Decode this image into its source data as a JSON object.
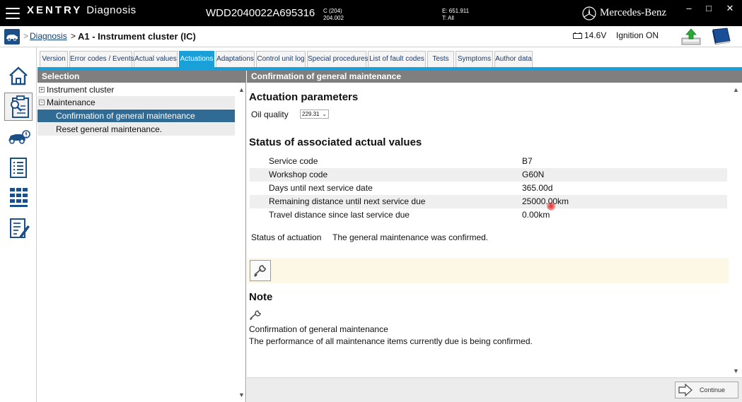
{
  "topbar": {
    "brand_bold": "XENTRY",
    "brand_rest": "Diagnosis",
    "vin": "WDD2040022A695316",
    "model_line1": "C (204)",
    "model_line2": "204.002",
    "engine_line1": "E: 651.911",
    "engine_line2": "T: All",
    "maker": "Mercedes-Benz",
    "minimize": "–",
    "maximize": "□",
    "close": "✕"
  },
  "breadcrumb": {
    "separator1": ">",
    "link": "Diagnosis",
    "separator2": ">",
    "current": "A1 - Instrument cluster (IC)"
  },
  "status": {
    "voltage": "14.6V",
    "ignition": "Ignition ON"
  },
  "tabs": [
    {
      "label": "Version"
    },
    {
      "label": "Error codes / Events"
    },
    {
      "label": "Actual values"
    },
    {
      "label": "Actuations"
    },
    {
      "label": "Adaptations"
    },
    {
      "label": "Control unit log"
    },
    {
      "label": "Special procedures"
    },
    {
      "label": "List of fault codes"
    },
    {
      "label": "Tests"
    },
    {
      "label": "Symptoms"
    },
    {
      "label": "Author data"
    }
  ],
  "selection": {
    "title": "Selection",
    "items": [
      {
        "label": "Instrument cluster",
        "toggle": "+"
      },
      {
        "label": "Maintenance",
        "toggle": "−"
      },
      {
        "label": "Confirmation of general maintenance"
      },
      {
        "label": "Reset general maintenance."
      }
    ]
  },
  "detail": {
    "title": "Confirmation of general maintenance",
    "params_heading": "Actuation parameters",
    "oil_label": "Oil quality",
    "oil_value": "229.31",
    "status_heading": "Status of associated actual values",
    "actual_values": [
      {
        "name": "Service code",
        "value": "B7"
      },
      {
        "name": "Workshop code",
        "value": "G60N"
      },
      {
        "name": "Days until next service date",
        "value": "365.00d"
      },
      {
        "name": "Remaining distance until next service due",
        "value": "25000.00km"
      },
      {
        "name": "Travel distance since last service due",
        "value": "0.00km"
      }
    ],
    "actuation_status_label": "Status of actuation",
    "actuation_status_value": "The general maintenance was confirmed.",
    "note_heading": "Note",
    "note_line1": "Confirmation of general maintenance",
    "note_line2": "The performance of all maintenance items currently due is being confirmed.",
    "continue_label": "Continue"
  },
  "colors": {
    "accent": "#1aa0d8",
    "selected_row": "#2f6b94",
    "panel_header": "#7f7f7f",
    "link": "#0b3f7a",
    "icon_blue": "#1b4f86"
  }
}
